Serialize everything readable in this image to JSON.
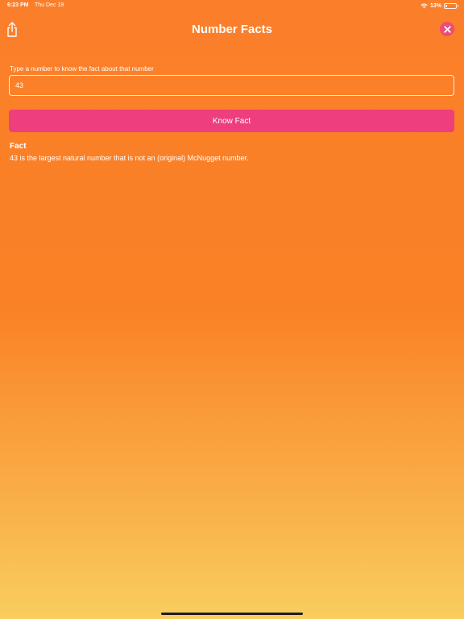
{
  "status_bar": {
    "time": "6:23 PM",
    "date": "Thu Dec 19",
    "battery_percent": "13%",
    "battery_level": 0.13,
    "icons": [
      "wifi-icon",
      "battery-icon"
    ]
  },
  "nav": {
    "title": "Number Facts",
    "left_icon": "share-icon",
    "right_icon": "close-icon"
  },
  "form": {
    "input_label": "Type a number to know the fact about that number",
    "input_value": "43",
    "button_label": "Know Fact"
  },
  "fact": {
    "heading": "Fact",
    "text": "43 is the largest natural number that is not an (original) McNugget number."
  },
  "colors": {
    "gradient_top": "#fb7f2a",
    "gradient_bottom": "#f9cd5e",
    "button": "#ef3e7d",
    "close_button": "#ef4b76"
  }
}
